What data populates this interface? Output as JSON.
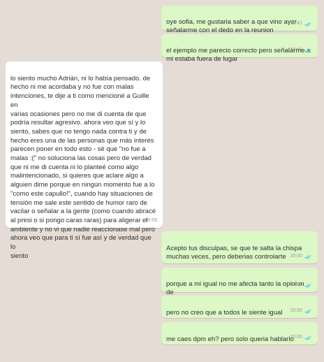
{
  "messages": [
    {
      "dir": "out",
      "text": "oye sofia, me gustaria saber a que vino ayer\nseñalarme con el dedo en la reunion",
      "time": "19:41",
      "read": true
    },
    {
      "dir": "out",
      "text": "el ejemplo me parecio correcto pero señalarme a\nmi estaba fuera de lugar",
      "time": "19:41",
      "read": true
    },
    {
      "dir": "in",
      "text": "lo siento mucho Adrián, ni lo había pensado. de\nhecho ni me acordaba y no fue con malas\nintenciones, te dije a ti como mencioné a Guille en\nvarias ocasiones pero no me di cuenta de que\npodría resultar agresivo. ahora veo que sí y lo\nsiento, sabes que no tengo nada contra ti y de\nhecho eres una de las personas que más interés\nparecen poner en todo esto - sé que \"no fue a\nmalas :(\" no soluciona las cosas pero de verdad\nque ni me di cuenta ni lo planteé como algo\nmalintencionado, si quieres que aclare algo a\nalguien dime porque en ningún momento fue a lo\n\"como este capullo!\", cuando hay situaciones de\ntensión me sale este sentido de humor raro de\nvacilar o señalar a la gente (como cuando abracé\nal presi o si pongo caras raras) para aligerar el\nambiente y no vi que nadie reaccionase mal pero\nahora veo que para ti sí fue así y de verdad que lo\nsiento",
      "time": "19:59",
      "read": false
    },
    {
      "dir": "out",
      "text": "Acepto tus disculpas, se que te salta la chispa\nmuchas veces, pero deberias controlarte",
      "time": "20:00",
      "read": true
    },
    {
      "dir": "out",
      "text": "porque a mi igual no me afecta tanto la opinion de\nlos demas",
      "time": "20:00",
      "read": true
    },
    {
      "dir": "out",
      "text": "pero no creo que a todos le siente igual",
      "time": "20:00",
      "read": true
    },
    {
      "dir": "out",
      "text": "me caes dpm eh? pero solo queria hablarlo",
      "time": "20:00",
      "read": true
    }
  ],
  "colors": {
    "outgoing": "#dcf8c6",
    "incoming": "#ffffff",
    "read_ticks": "#4fc3f7",
    "background": "#e5ddd5"
  }
}
